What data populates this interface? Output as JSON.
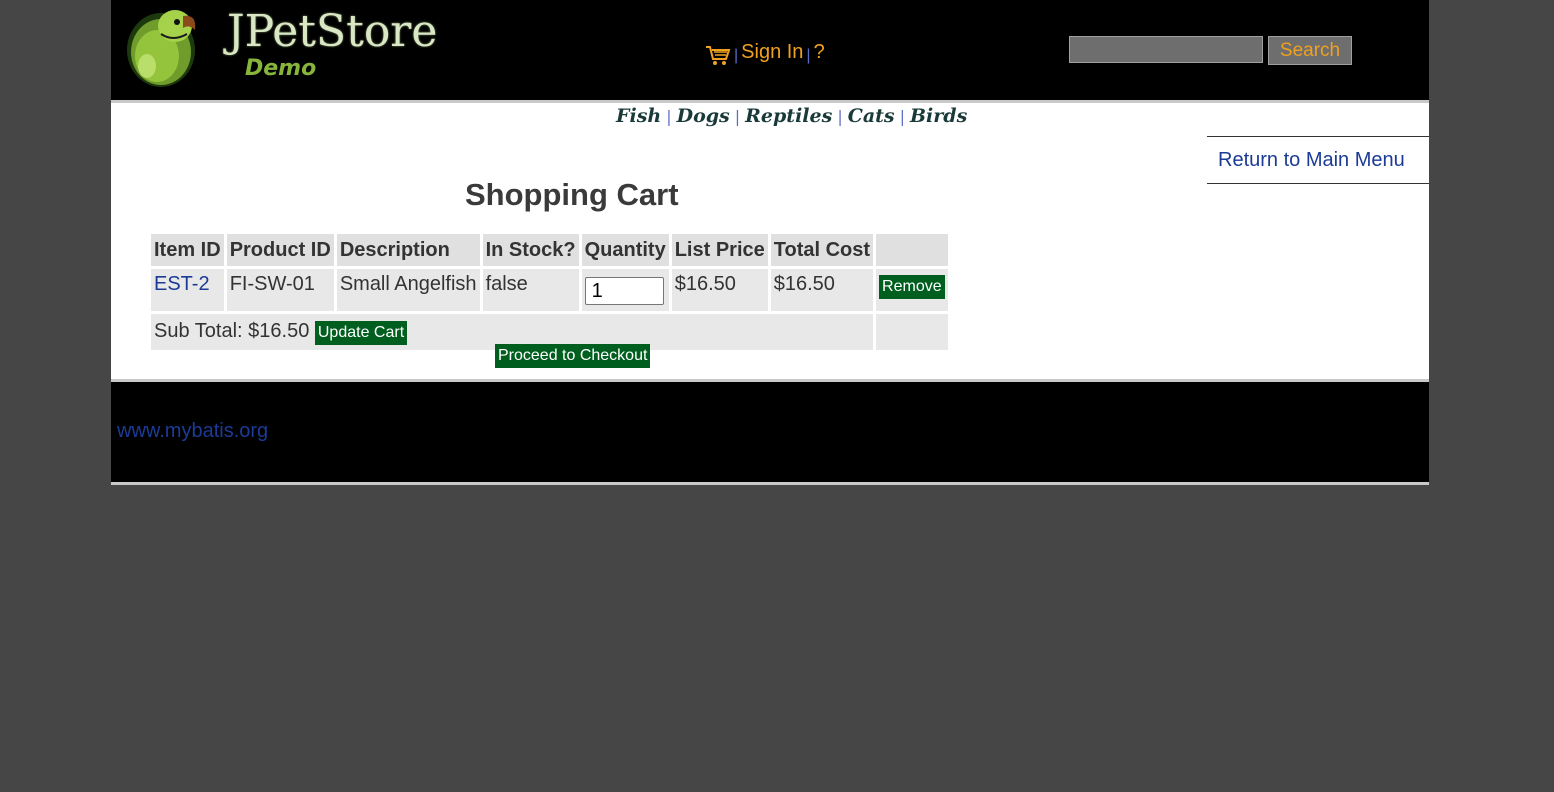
{
  "header": {
    "logo_title": "JPetStore",
    "logo_subtitle": "Demo",
    "sign_in_label": "Sign In",
    "help_label": "?",
    "separator": "|",
    "search_placeholder": "",
    "search_button_label": "Search"
  },
  "quicklinks": {
    "fish": "Fish",
    "dogs": "Dogs",
    "reptiles": "Reptiles",
    "cats": "Cats",
    "birds": "Birds",
    "separator": "|"
  },
  "back_link_label": "Return to Main Menu",
  "cart": {
    "title": "Shopping Cart",
    "headers": [
      "Item ID",
      "Product ID",
      "Description",
      "In Stock?",
      "Quantity",
      "List Price",
      "Total Cost"
    ],
    "items": [
      {
        "item_id": "EST-2",
        "product_id": "FI-SW-01",
        "description": "Small Angelfish",
        "in_stock": "false",
        "quantity": "1",
        "list_price": "$16.50",
        "total_cost": "$16.50",
        "remove_label": "Remove"
      }
    ],
    "subtotal": "Sub Total: $16.50",
    "update_label": "Update Cart",
    "checkout_label": "Proceed to Checkout"
  },
  "footer": {
    "link_label": "www.mybatis.org"
  },
  "icons": {
    "logo": "parrot-logo-icon",
    "cart": "shopping-cart-icon"
  },
  "colors": {
    "header_bg": "#000000",
    "page_bg": "#464646",
    "header_link": "#f0a020",
    "link": "#1c3b96",
    "button_green": "#005f1f"
  }
}
